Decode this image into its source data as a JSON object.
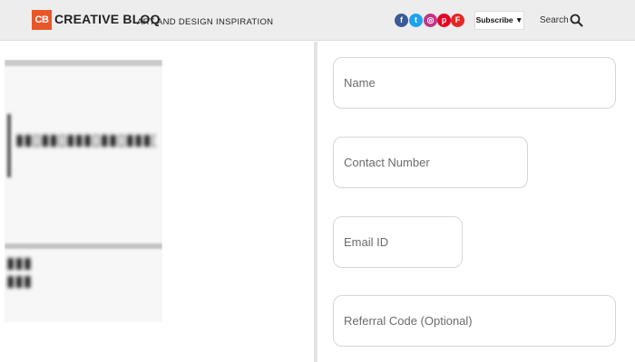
{
  "header": {
    "logo_mark": "CB",
    "logo_text": "CREATIVE BLOQ",
    "tagline": "ART AND DESIGN INSPIRATION",
    "social": [
      {
        "name": "facebook-icon",
        "glyph": "f",
        "color": "#3b5998"
      },
      {
        "name": "twitter-icon",
        "glyph": "t",
        "color": "#1da1f2"
      },
      {
        "name": "instagram-icon",
        "glyph": "◎",
        "color": "#c13584"
      },
      {
        "name": "pinterest-icon",
        "glyph": "p",
        "color": "#e60023"
      },
      {
        "name": "flipboard-icon",
        "glyph": "F",
        "color": "#e12828"
      }
    ],
    "subscribe_label": "Subscribe ▼",
    "search_label": "Search"
  },
  "form": {
    "name_placeholder": "Name",
    "contact_placeholder": "Contact Number",
    "email_placeholder": "Email ID",
    "referral_placeholder": "Referral Code (Optional)"
  }
}
